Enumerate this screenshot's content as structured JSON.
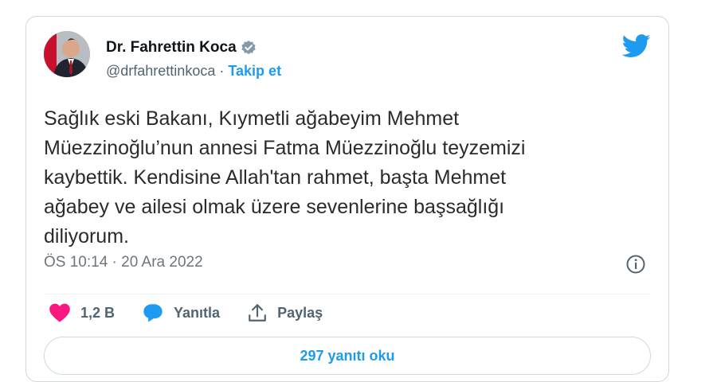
{
  "tweet": {
    "author_name": "Dr. Fahrettin Koca",
    "handle": "@drfahrettinkoca",
    "separator": "·",
    "follow_label": "Takip et",
    "text": "Sağlık eski Bakanı, Kıymetli ağabeyim Mehmet\nMüezzinoğlu’nun annesi Fatma Müezzinoğlu teyzemizi\nkaybettik. Kendisine Allah'tan rahmet, başta Mehmet\nağabey ve ailesi olmak üzere sevenlerine başsağlığı\ndiliyorum.",
    "timestamp": "ÖS 10:14 · 20 Ara 2022"
  },
  "actions": {
    "like_count": "1,2 B",
    "reply_label": "Yanıtla",
    "share_label": "Paylaş",
    "read_replies_label": "297 yanıtı oku"
  },
  "colors": {
    "accent": "#1d9bf0",
    "like": "#f91880",
    "verified": "#829aab"
  },
  "icons": [
    "verified-badge-icon",
    "twitter-bird-icon",
    "info-icon",
    "heart-icon",
    "reply-icon",
    "share-icon"
  ]
}
